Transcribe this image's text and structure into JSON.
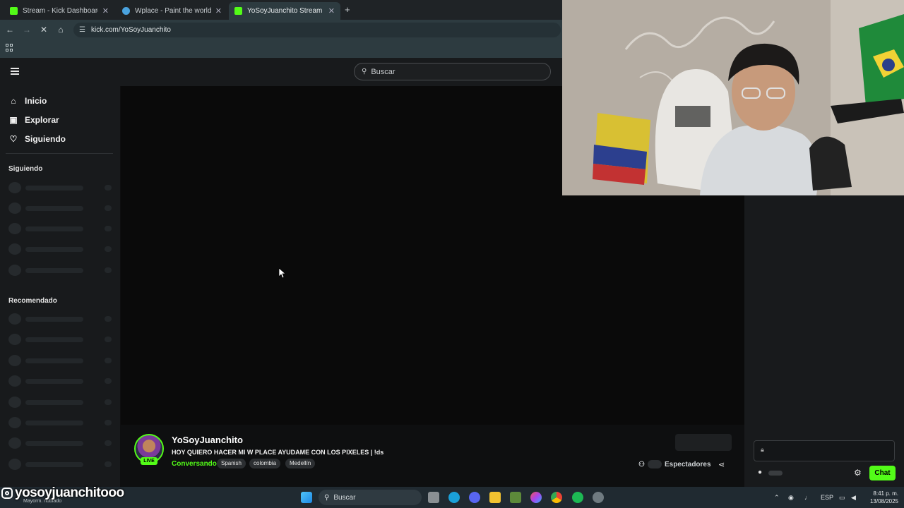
{
  "browser": {
    "tabs": [
      {
        "title": "Stream - Kick Dashboard",
        "favicon_color": "#53fc18"
      },
      {
        "title": "Wplace - Paint the world",
        "favicon_color": "#4aa3df"
      },
      {
        "title": "YoSoyJuanchito Stream - Watch",
        "favicon_color": "#53fc18"
      }
    ],
    "address": "kick.com/YoSoyJuanchito"
  },
  "kick": {
    "search_placeholder": "Buscar",
    "nav": [
      {
        "label": "Inicio",
        "icon": "home-icon"
      },
      {
        "label": "Explorar",
        "icon": "explore-icon"
      },
      {
        "label": "Siguiendo",
        "icon": "heart-icon"
      }
    ],
    "sections": {
      "following": "Siguiendo",
      "recommended": "Recomendado"
    },
    "stream": {
      "username": "YoSoyJuanchito",
      "title": "HOY QUIERO HACER MI W PLACE AYUDAME CON LOS PIXELES | !ds",
      "category": "Conversando",
      "tags": [
        "Spanish",
        "colombia",
        "Medellín"
      ],
      "live_badge": "LIVE",
      "viewers_label": "Espectadores"
    },
    "chat": {
      "button": "Chat"
    },
    "accent": "#53fc18"
  },
  "overlay": {
    "instagram_handle": "yosoyjuanchitooo",
    "caption": "Mayorm. nublado"
  },
  "taskbar": {
    "search_placeholder": "Buscar",
    "lang": "ESP",
    "time": "8:41 p. m.",
    "date": "13/08/2025"
  }
}
